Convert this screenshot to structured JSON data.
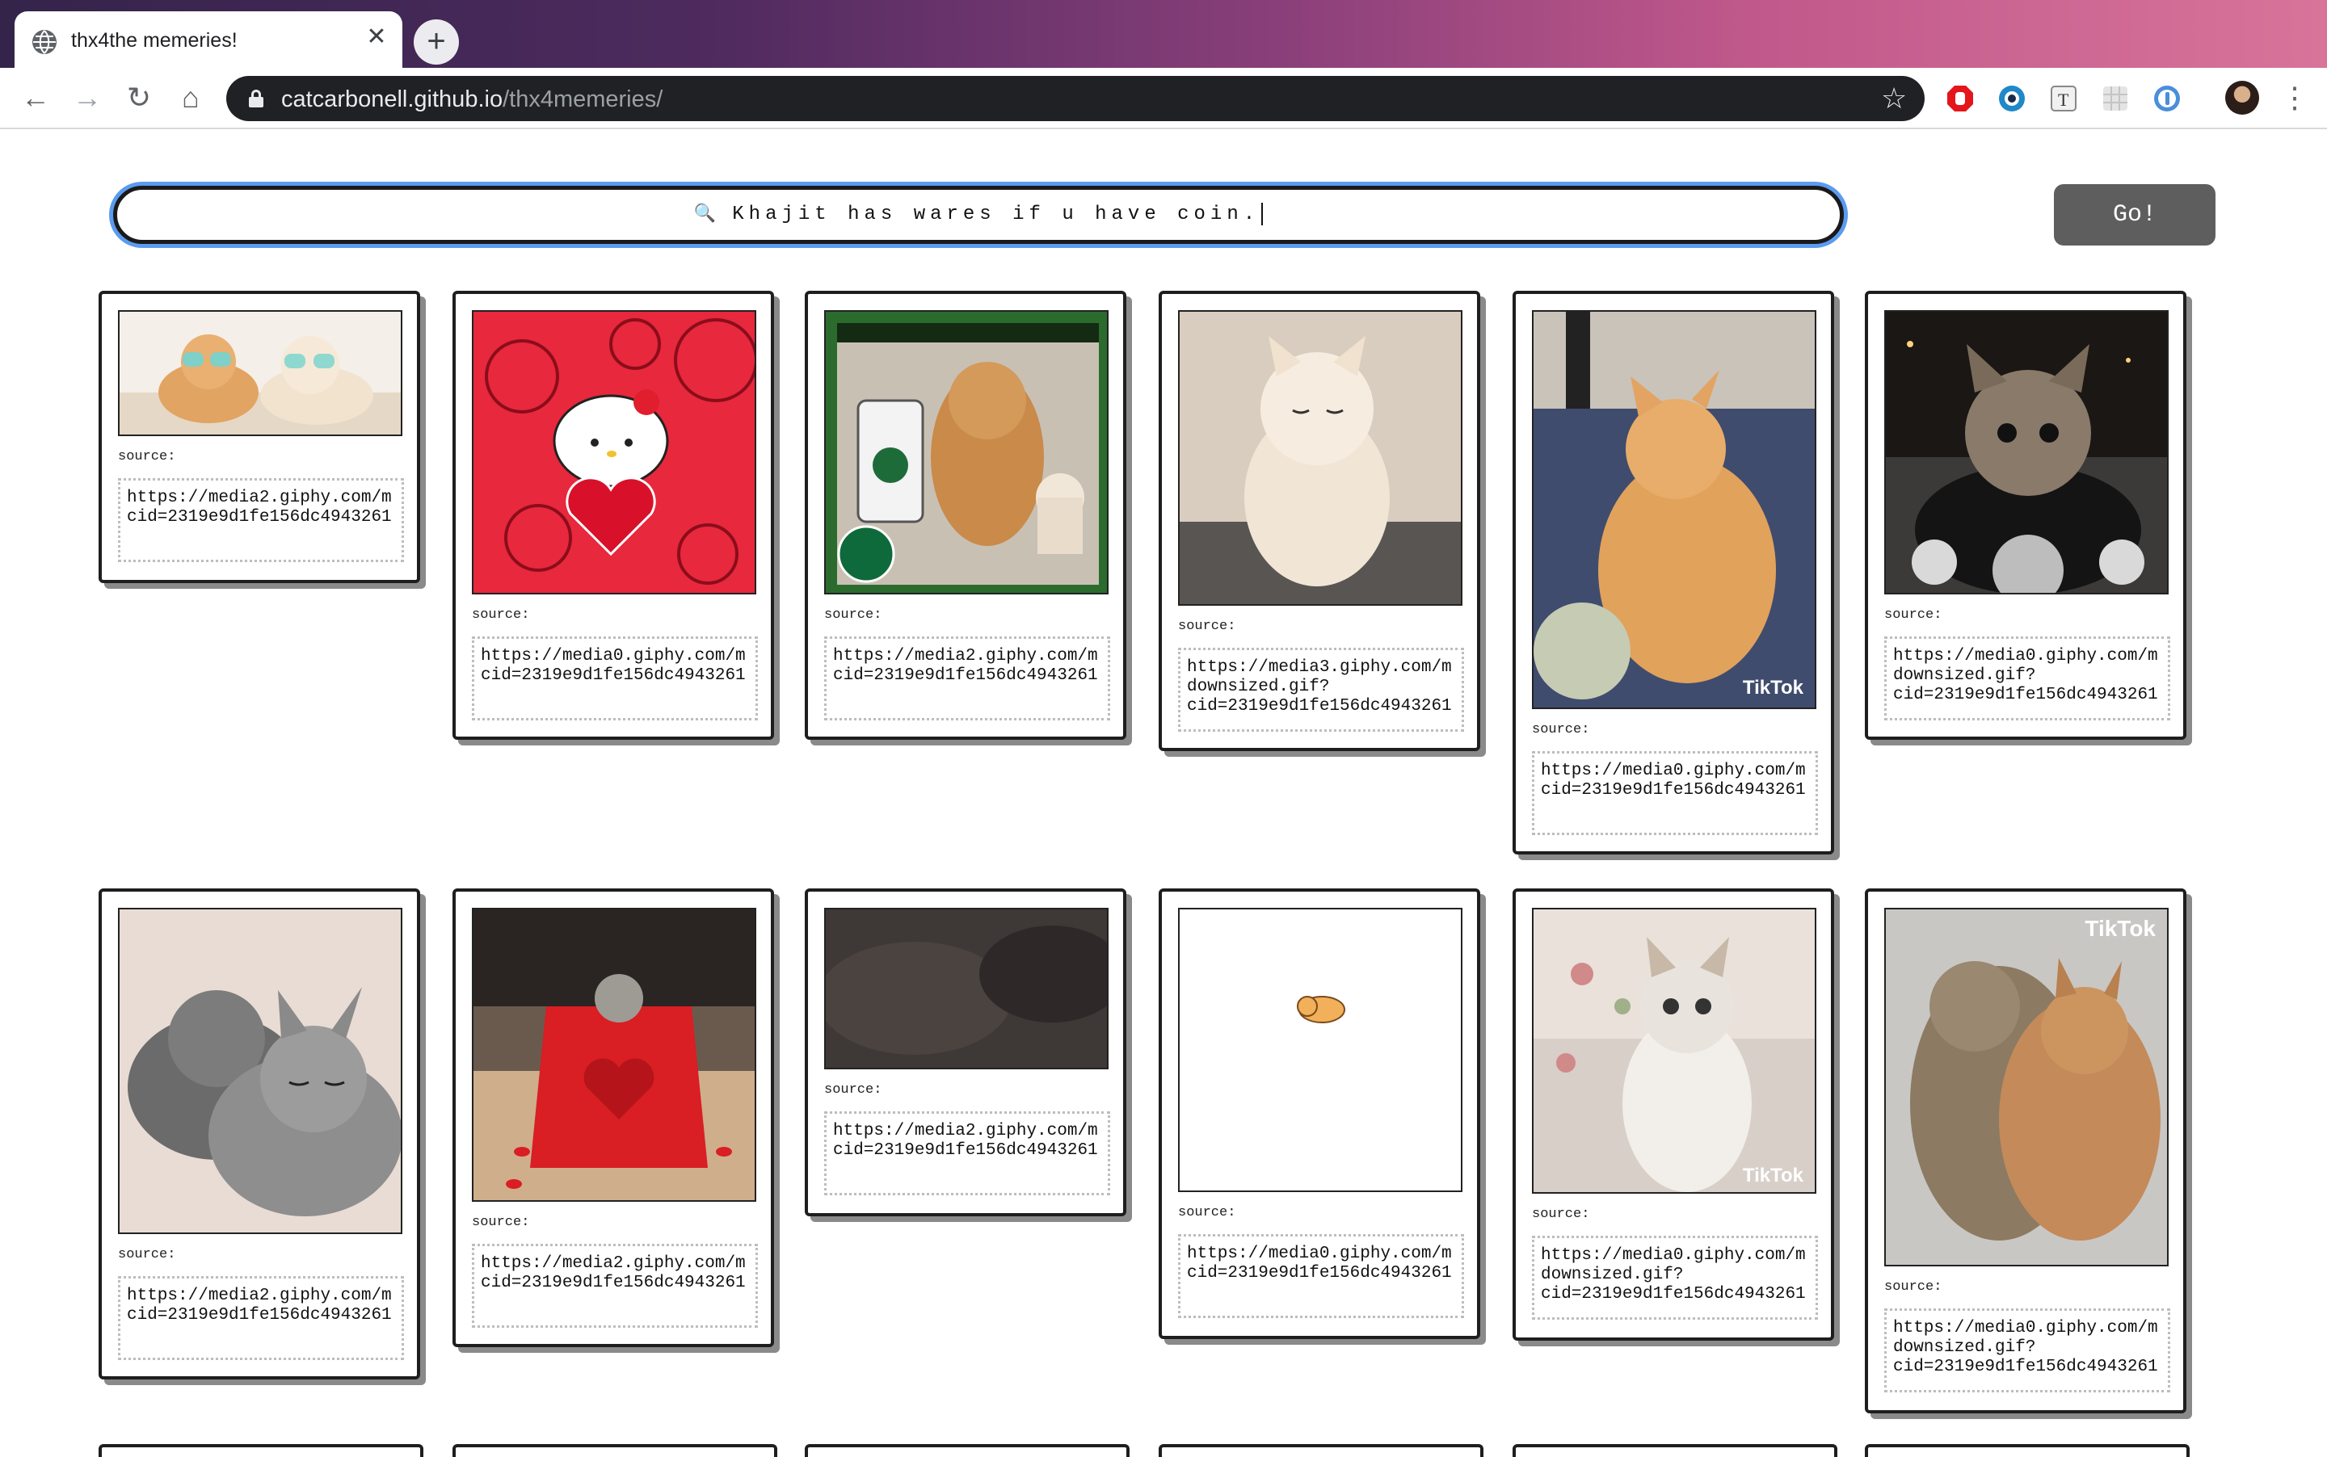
{
  "browser": {
    "tab_title": "thx4the memeries!",
    "tab_close": "✕",
    "new_tab": "+",
    "back": "←",
    "forward": "→",
    "reload": "↻",
    "home": "⌂",
    "url_host": "catcarbonell.github.io",
    "url_path": "/thx4memeries/",
    "bookmark_star": "☆",
    "menu": "⋮"
  },
  "search": {
    "magnifier": "🔍",
    "value": "Khajit has wares if u have coin.",
    "go_label": "Go!"
  },
  "cards": [
    {
      "source_label": "source:",
      "url": "https://media2.giphy.com/m\ncid=2319e9d1fe156dc4943261",
      "image": "cats-with-heart-glasses"
    },
    {
      "source_label": "source:",
      "url": "https://media0.giphy.com/m\ncid=2319e9d1fe156dc4943261",
      "image": "hello-kitty-heart"
    },
    {
      "source_label": "source:",
      "url": "https://media2.giphy.com/m\ncid=2319e9d1fe156dc4943261",
      "image": "cat-starbucks-cup"
    },
    {
      "source_label": "source:",
      "url": "https://media3.giphy.com/m\ndownsized.gif?\ncid=2319e9d1fe156dc4943261",
      "image": "sleepy-kitten"
    },
    {
      "source_label": "source:",
      "url": "https://media0.giphy.com/m\ncid=2319e9d1fe156dc4943261",
      "image": "orange-kitten-bed",
      "watermark": "TikTok"
    },
    {
      "source_label": "source:",
      "url": "https://media0.giphy.com/m\ndownsized.gif?\ncid=2319e9d1fe156dc4943261",
      "image": "cat-on-motorcycle"
    },
    {
      "source_label": "source:",
      "url": "https://media2.giphy.com/m\ncid=2319e9d1fe156dc4943261",
      "image": "kittens-cuddling"
    },
    {
      "source_label": "source:",
      "url": "https://media2.giphy.com/m\ncid=2319e9d1fe156dc4943261",
      "image": "kitten-red-gift-bag"
    },
    {
      "source_label": "source:",
      "url": "https://media2.giphy.com/m\ncid=2319e9d1fe156dc4943261",
      "image": "dark-cat-fur"
    },
    {
      "source_label": "source:",
      "url": "https://media0.giphy.com/m\ncid=2319e9d1fe156dc4943261",
      "image": "tiny-cartoon-cat"
    },
    {
      "source_label": "source:",
      "url": "https://media0.giphy.com/m\ndownsized.gif?\ncid=2319e9d1fe156dc4943261",
      "image": "kitten-praying",
      "watermark": "TikTok"
    },
    {
      "source_label": "source:",
      "url": "https://media0.giphy.com/m\ndownsized.gif?\ncid=2319e9d1fe156dc4943261",
      "image": "two-cats-hugging",
      "watermark": "TikTok"
    }
  ],
  "colors": {
    "focus_ring": "#5b9bf0",
    "go_button": "#5e5e5e",
    "card_border": "#1e1e1e",
    "card_shadow": "#8a8a8a"
  }
}
